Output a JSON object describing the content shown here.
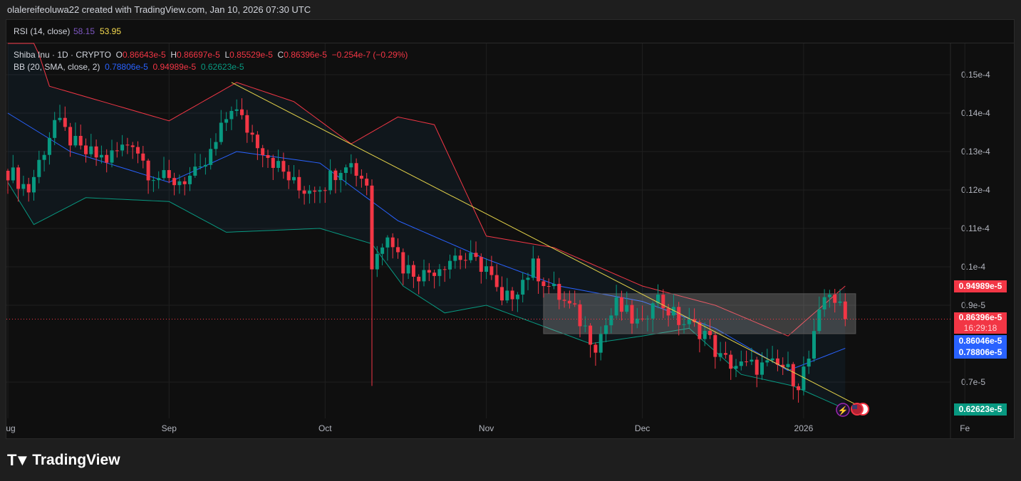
{
  "header": "olalereifeoluwa22 created with TradingView.com, Jan 10, 2026 07:30 UTC",
  "rsi": {
    "label": "RSI (14, close)",
    "v1": "58.15",
    "v2": "53.95"
  },
  "legend": {
    "symbol": "Shiba Inu · 1D · CRYPTO",
    "o_l": "O",
    "o": "0.86643e-5",
    "h_l": "H",
    "h": "0.86697e-5",
    "l_l": "L",
    "l": "0.85529e-5",
    "c_l": "C",
    "c": "0.86396e-5",
    "chg": "−0.254e-7 (−0.29%)",
    "bb": "BB (20, SMA, close, 2)",
    "bb_mid": "0.78806e-5",
    "bb_up": "0.94989e-5",
    "bb_low": "0.62623e-5"
  },
  "price_labels": {
    "upper": "0.94989e-5",
    "last": "0.86396e-5",
    "countdown": "16:29:18",
    "blue": "0.86046e-5",
    "mid": "0.78806e-5",
    "lower": "0.62623e-5"
  },
  "colors": {
    "up": "#089981",
    "down": "#f23645",
    "mid": "#2962ff",
    "upper": "#f23645",
    "lower": "#089981",
    "trend": "#e5d34a"
  },
  "footer": "TradingView",
  "chart_data": {
    "type": "candlestick",
    "unit": "e-5",
    "y_ticks": [
      {
        "v": 1.5,
        "label": "0.15e-4"
      },
      {
        "v": 1.4,
        "label": "0.14e-4"
      },
      {
        "v": 1.3,
        "label": "0.13e-4"
      },
      {
        "v": 1.2,
        "label": "0.12e-4"
      },
      {
        "v": 1.1,
        "label": "0.11e-4"
      },
      {
        "v": 1.0,
        "label": "0.1e-4"
      },
      {
        "v": 0.9,
        "label": "0.9e-5"
      },
      {
        "v": 0.7,
        "label": "0.7e-5"
      }
    ],
    "x_ticks": [
      {
        "d": 0,
        "label": "Aug"
      },
      {
        "d": 31,
        "label": "Sep"
      },
      {
        "d": 61,
        "label": "Oct"
      },
      {
        "d": 92,
        "label": "Nov"
      },
      {
        "d": 122,
        "label": "Dec"
      },
      {
        "d": 153,
        "label": "2026"
      },
      {
        "d": 184,
        "label": "Fe"
      }
    ],
    "close_anchors": [
      [
        0,
        1.25
      ],
      [
        4,
        1.2
      ],
      [
        9,
        1.38
      ],
      [
        14,
        1.3
      ],
      [
        19,
        1.28
      ],
      [
        24,
        1.33
      ],
      [
        27,
        1.25
      ],
      [
        31,
        1.22
      ],
      [
        37,
        1.24
      ],
      [
        40,
        1.32
      ],
      [
        43,
        1.42
      ],
      [
        46,
        1.36
      ],
      [
        52,
        1.26
      ],
      [
        56,
        1.2
      ],
      [
        61,
        1.22
      ],
      [
        65,
        1.28
      ],
      [
        69,
        1.22
      ],
      [
        70,
        1.0
      ],
      [
        73,
        1.1
      ],
      [
        76,
        1.0
      ],
      [
        80,
        0.98
      ],
      [
        86,
        1.03
      ],
      [
        92,
        1.0
      ],
      [
        95,
        0.9
      ],
      [
        101,
        1.0
      ],
      [
        104,
        0.95
      ],
      [
        109,
        0.88
      ],
      [
        113,
        0.8
      ],
      [
        117,
        0.9
      ],
      [
        122,
        0.84
      ],
      [
        124,
        0.93
      ],
      [
        129,
        0.86
      ],
      [
        134,
        0.83
      ],
      [
        137,
        0.76
      ],
      [
        141,
        0.74
      ],
      [
        149,
        0.74
      ],
      [
        152,
        0.7
      ],
      [
        154,
        0.76
      ],
      [
        157,
        0.92
      ],
      [
        158,
        0.94
      ],
      [
        161,
        0.864
      ]
    ],
    "bb_upper": [
      [
        0,
        1.8
      ],
      [
        8,
        1.47
      ],
      [
        31,
        1.38
      ],
      [
        44,
        1.48
      ],
      [
        55,
        1.43
      ],
      [
        66,
        1.32
      ],
      [
        75,
        1.39
      ],
      [
        82,
        1.37
      ],
      [
        92,
        1.08
      ],
      [
        105,
        1.05
      ],
      [
        122,
        0.95
      ],
      [
        136,
        0.9
      ],
      [
        150,
        0.82
      ],
      [
        161,
        0.95
      ]
    ],
    "bb_mid": [
      [
        0,
        1.4
      ],
      [
        12,
        1.3
      ],
      [
        31,
        1.22
      ],
      [
        44,
        1.3
      ],
      [
        60,
        1.27
      ],
      [
        75,
        1.12
      ],
      [
        92,
        1.02
      ],
      [
        106,
        0.95
      ],
      [
        122,
        0.91
      ],
      [
        136,
        0.84
      ],
      [
        150,
        0.73
      ],
      [
        161,
        0.788
      ]
    ],
    "bb_lower": [
      [
        0,
        1.22
      ],
      [
        5,
        1.11
      ],
      [
        15,
        1.18
      ],
      [
        31,
        1.17
      ],
      [
        42,
        1.09
      ],
      [
        60,
        1.1
      ],
      [
        70,
        1.06
      ],
      [
        76,
        0.95
      ],
      [
        84,
        0.88
      ],
      [
        92,
        0.9
      ],
      [
        112,
        0.8
      ],
      [
        122,
        0.82
      ],
      [
        131,
        0.84
      ],
      [
        141,
        0.72
      ],
      [
        151,
        0.69
      ],
      [
        161,
        0.63
      ]
    ],
    "trendline": [
      [
        43,
        1.48
      ],
      [
        164,
        0.635
      ]
    ],
    "range_box": {
      "from": 103,
      "to": 163,
      "top": 0.93,
      "bottom": 0.826
    },
    "crash_wick_low": 0.69,
    "last_price": 0.864
  }
}
